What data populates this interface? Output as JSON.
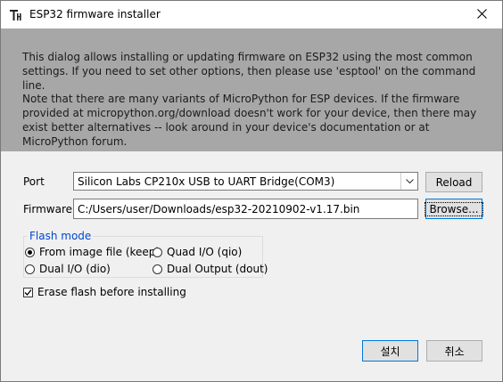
{
  "window": {
    "title": "ESP32 firmware installer",
    "app_icon": "thonny-icon",
    "close_icon": "close-icon"
  },
  "banner": {
    "para1": "This dialog allows installing or updating firmware on ESP32 using the most common settings. If you need to set other options, then please use 'esptool' on the command line.",
    "para2": "Note that there are many variants of MicroPython for ESP devices. If the firmware provided at micropython.org/download doesn't work for your device, then there may exist better alternatives -- look around in your device's documentation or at MicroPython forum."
  },
  "port": {
    "label": "Port",
    "selected": "Silicon Labs CP210x USB to UART Bridge(COM3)",
    "reload_label": "Reload"
  },
  "firmware": {
    "label": "Firmware",
    "value": "C:/Users/user/Downloads/esp32-20210902-v1.17.bin",
    "browse_label": "Browse..."
  },
  "flash_mode": {
    "title": "Flash mode",
    "options": [
      {
        "label": "From image file (keep)",
        "selected": true
      },
      {
        "label": "Quad I/O (qio)",
        "selected": false
      },
      {
        "label": "Dual I/O (dio)",
        "selected": false
      },
      {
        "label": "Dual Output (dout)",
        "selected": false
      }
    ]
  },
  "erase": {
    "label": "Erase flash before installing",
    "checked": true
  },
  "footer": {
    "install_label": "설치",
    "cancel_label": "취소"
  }
}
